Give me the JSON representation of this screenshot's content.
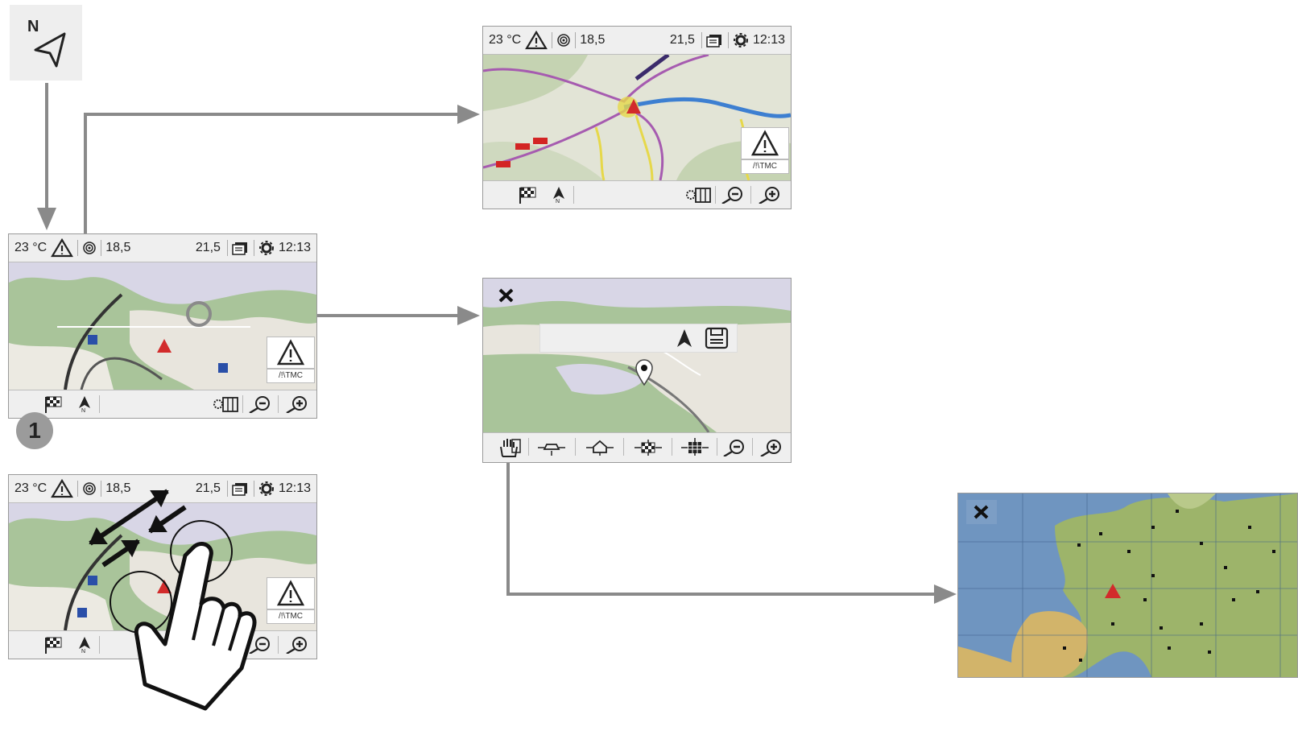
{
  "status_bar": {
    "temperature": "23 °C",
    "distance_left": "18,5",
    "distance_right": "21,5",
    "time": "12:13"
  },
  "tmc_label": "/!\\TMC",
  "step_badge": "1",
  "compass_letter": "N",
  "north_glyph": "N",
  "icons": {
    "compass": "compass-north-icon",
    "warning": "warning-triangle-icon",
    "gps": "gps-signal-icon",
    "messages": "messages-icon",
    "settings": "settings-gear-icon",
    "destination": "checkered-flag-icon",
    "north_up": "north-arrow-icon",
    "map_settings": "map-settings-icon",
    "zoom_out": "zoom-out-icon",
    "zoom_in": "zoom-in-icon",
    "close": "close-icon",
    "navigate": "navigate-arrow-icon",
    "save": "save-icon",
    "pan": "hand-pan-icon",
    "pin": "location-pin-icon",
    "hand": "hand-gesture-icon"
  },
  "colors": {
    "map_green": "#a9c49a",
    "map_light": "#e8e5dd",
    "route_blue": "#3d7fd1",
    "road_purple": "#a65bb0",
    "road_yellow": "#e6d84a",
    "arrow_gray": "#8a8a8a",
    "vehicle_red": "#d22b2b"
  }
}
